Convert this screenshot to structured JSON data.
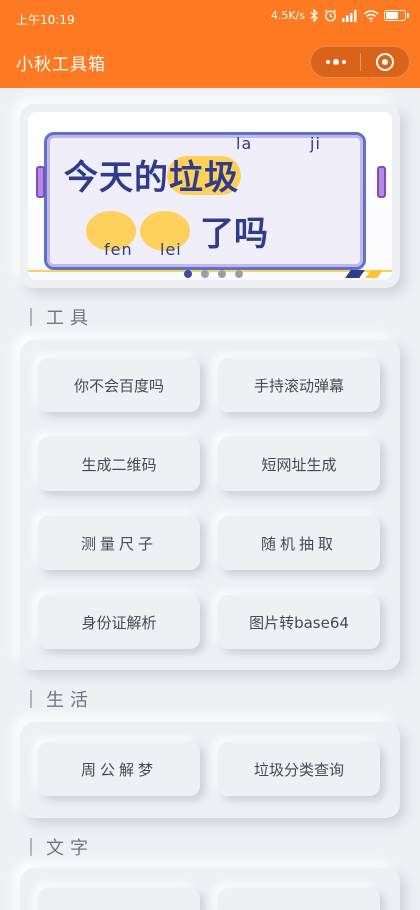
{
  "status_bar": {
    "time": "上午10:19",
    "net_speed": "4.5K/s",
    "icons": [
      "bluetooth-icon",
      "alarm-icon",
      "signal-icon",
      "wifi-icon",
      "battery-icon"
    ]
  },
  "title_bar": {
    "title": "小秋工具箱",
    "more_icon": "more-dots-icon",
    "close_icon": "mini-program-close-icon"
  },
  "banner": {
    "line1_plain": "今天的",
    "line1_highlight": "垃圾",
    "line2": "了吗",
    "pinyin": {
      "la": "la",
      "ji": "ji",
      "fen": "fen",
      "lei": "lei"
    },
    "slide_count": 4,
    "active_slide": 1
  },
  "sections": {
    "tools": {
      "title": "工具",
      "buttons": [
        "你不会百度吗",
        "手持滚动弹幕",
        "生成二维码",
        "短网址生成",
        "测量尺子",
        "随机抽取",
        "身份证解析",
        "图片转base64"
      ]
    },
    "life": {
      "title": "生活",
      "buttons": [
        "周公解梦",
        "垃圾分类查询"
      ]
    },
    "text": {
      "title": "文字"
    }
  },
  "colors": {
    "brand_orange": "#fd7a22",
    "background": "#eef0f4",
    "banner_navy": "#2f3c8c",
    "banner_yellow": "#fdd15c"
  }
}
